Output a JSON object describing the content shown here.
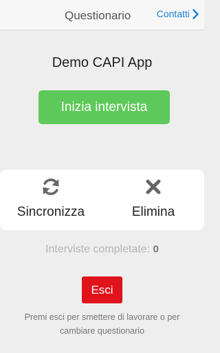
{
  "navbar": {
    "title": "Questionario",
    "contacts_label": "Contatti",
    "accent_color": "#1a7fd6"
  },
  "main": {
    "app_title": "Demo CAPI App",
    "start_button_label": "Inizia intervista",
    "start_button_color": "#5dc95a"
  },
  "actions": {
    "sync": {
      "label": "Sincronizza",
      "icon": "sync-icon"
    },
    "delete": {
      "label": "Elimina",
      "icon": "close-icon"
    }
  },
  "stats": {
    "completed_label": "Interviste completate:",
    "completed_count": "0"
  },
  "exit": {
    "button_label": "Esci",
    "button_color": "#e0121b",
    "hint": "Premi esci per smettere di lavorare o per cambiare questionario"
  }
}
